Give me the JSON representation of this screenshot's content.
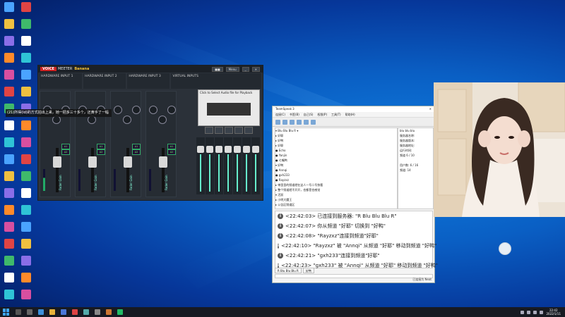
{
  "desktop": {
    "icons": [
      "",
      "",
      "",
      "",
      "",
      "",
      "",
      "",
      "",
      "",
      "",
      "",
      "",
      "",
      "",
      "",
      "",
      "",
      "",
      "",
      "",
      "",
      "",
      "",
      "",
      "",
      "",
      "",
      "",
      "",
      "",
      "",
      "",
      "",
      "",
      ""
    ]
  },
  "voicemeeter": {
    "brand": "VOICE",
    "brand_sub": "MEETER",
    "brand_tag": "Banana",
    "menu_label": "Menu",
    "strips": [
      {
        "title": "HARDWARE INPUT 1",
        "sub": ""
      },
      {
        "title": "HARDWARE INPUT 2",
        "sub": ""
      },
      {
        "title": "HARDWARE INPUT 3",
        "sub": ""
      },
      {
        "title": "VIRTUAL INPUTS",
        "sub": ""
      }
    ],
    "fader_label": "Fader Gain",
    "cassette_text": "Click to Select Audio file for Playback",
    "bus_buttons": [
      "A1",
      "A2",
      "A3",
      "B1",
      "B2"
    ]
  },
  "subtitle": {
    "text": "(21)所得(ld)的方式拍出上来，她一把多三十多个，还黄手了一幅"
  },
  "teamspeak": {
    "title": "TeamSpeak 3",
    "menu": [
      "连接(C)",
      "书签(B)",
      "自己(S)",
      "权限(P)",
      "工具(T)",
      "帮助(H)"
    ],
    "tree": [
      "▾ Blu Blu Blu R ▾",
      "  ▸ 好耶",
      "  ▸ 好鸭",
      "  ▸ 好耶",
      "    ● Echo",
      "    ● Yanjin",
      "    ● 七嘴鸭",
      "  ▾ 好鸭",
      "    ● Annqi",
      "    ● gxh233",
      "    ● Rayzxz",
      "  ▸ 带歪歪的频道就在这人一号二号快看",
      "  ▸ 整个频道就不开开，也都是也感觉",
      "  ▾ 活跃",
      "  ▸ 小明大魔王",
      "    ▸ 公告区频道区"
    ],
    "info_rows": [
      "blu blu blu",
      "服务器名称: ",
      "服务器版本: ",
      "服务器地址: ",
      "运行时间: ",
      "频道 6 / 10",
      "",
      "用户数: 6 / 16",
      "频道: 14"
    ],
    "log": [
      {
        "time": "<22:42:03>",
        "text": "已连接到服务器: \"R Blu Blu Blu R\""
      },
      {
        "time": "<22:42:07>",
        "text": "你从频道 \"好耶\" 切换到 \"好鸭\""
      },
      {
        "time": "<22:42:08>",
        "text": "\"Rayzxz\"连接到频道\"好耶\""
      },
      {
        "time": "<22:42:10>",
        "text": "\"Rayzxz\" 被 \"Annqi\" 从频道 \"好耶\" 移动到频道 \"好鸭\""
      },
      {
        "time": "<22:42:21>",
        "text": "\"gxh233\"连接到频道\"好耶\""
      },
      {
        "time": "<22:42:23>",
        "text": "\"gxh233\" 被 \"Annqi\" 从频道 \"好耶\" 移动到频道 \"好鸭\""
      }
    ],
    "tabs": [
      "R Blu Blu Blu R",
      "好鸭"
    ],
    "status": "已连接为 Neat"
  },
  "taskbar": {
    "clock_time": "22:42",
    "clock_date": "2022/1/11"
  },
  "colors": {
    "desktop_bg": "#0a5fc4",
    "vm_bg": "#2b3139",
    "accent_green": "#6ec9a9"
  }
}
